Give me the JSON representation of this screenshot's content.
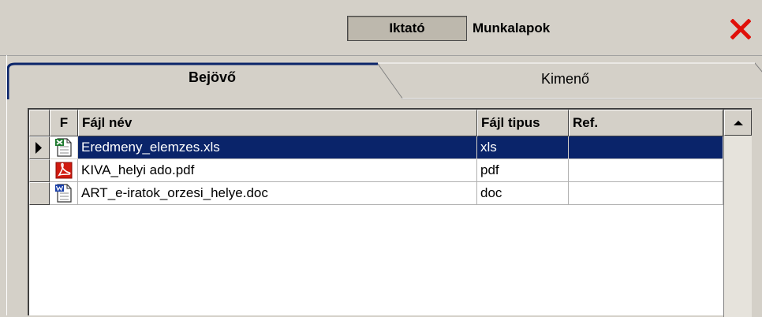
{
  "toolbar": {
    "iktato_label": "Iktató",
    "munkalapok_label": "Munkalapok",
    "close_icon": "close-x-icon"
  },
  "tabs": [
    {
      "label": "Bejövő",
      "active": true
    },
    {
      "label": "Kimenő",
      "active": false
    }
  ],
  "grid": {
    "columns": [
      "F",
      "Fájl név",
      "Fájl tipus",
      "Ref."
    ],
    "rows": [
      {
        "icon": "excel-file-icon",
        "name": "Eredmeny_elemzes.xls",
        "type": "xls",
        "ref": "",
        "selected": true
      },
      {
        "icon": "pdf-file-icon",
        "name": "KIVA_helyi ado.pdf",
        "type": "pdf",
        "ref": "",
        "selected": false
      },
      {
        "icon": "word-file-icon",
        "name": "ART_e-iratok_orzesi_helye.doc",
        "type": "doc",
        "ref": "",
        "selected": false
      }
    ]
  },
  "colors": {
    "selection": "#0a246a",
    "tab_accent": "#0a246a",
    "close": "#e0100a"
  }
}
